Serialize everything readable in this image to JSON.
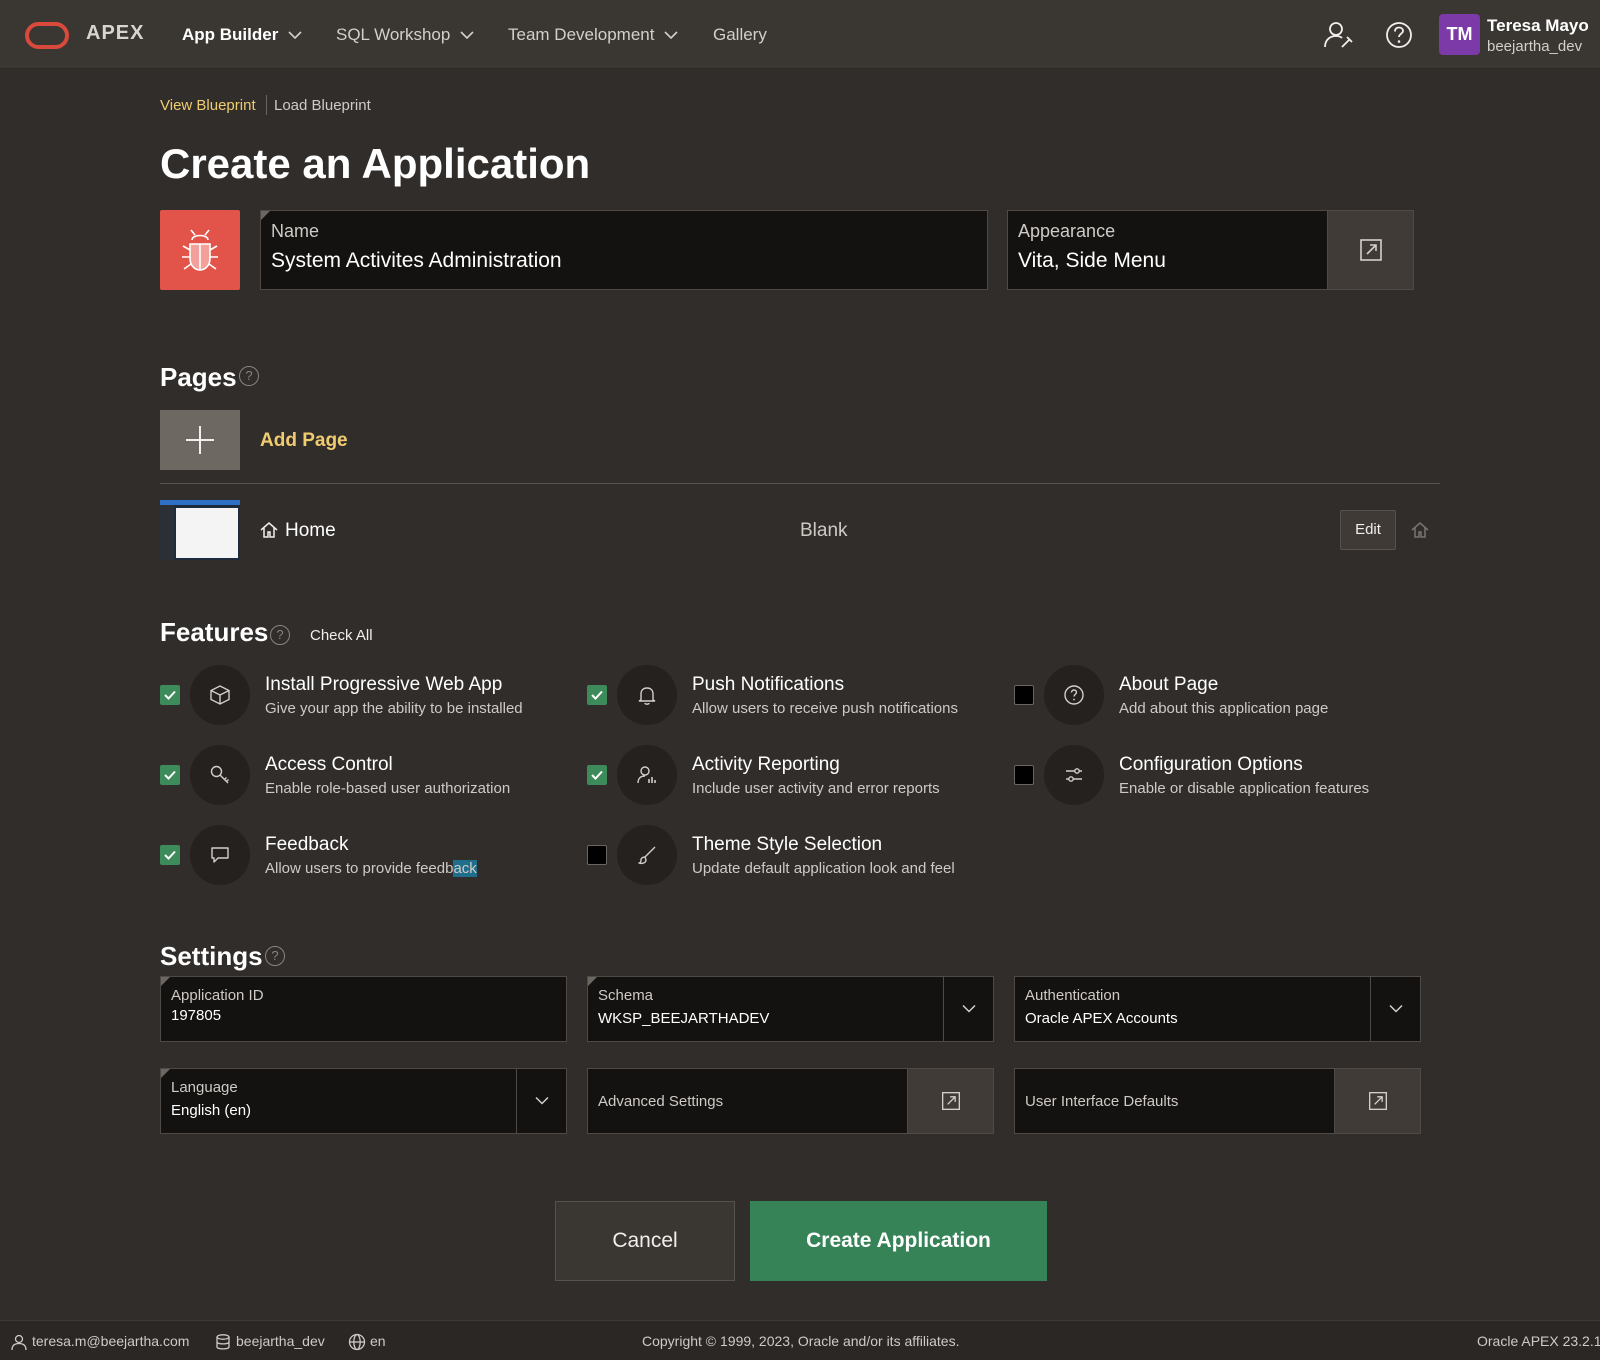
{
  "header": {
    "logo_text": "APEX",
    "nav": [
      {
        "label": "App Builder",
        "active": true
      },
      {
        "label": "SQL Workshop"
      },
      {
        "label": "Team Development"
      },
      {
        "label": "Gallery"
      }
    ],
    "user": {
      "initials": "TM",
      "name": "Teresa Mayo",
      "workspace": "beejartha_dev"
    }
  },
  "blueprint": {
    "view": "View Blueprint",
    "load": "Load Blueprint"
  },
  "title": "Create an Application",
  "name_field": {
    "label": "Name",
    "value": "System Activites Administration"
  },
  "appearance_field": {
    "label": "Appearance",
    "value": "Vita, Side Menu"
  },
  "pages": {
    "heading": "Pages",
    "add_label": "Add Page",
    "rows": [
      {
        "name": "Home",
        "type": "Blank",
        "edit_label": "Edit"
      }
    ]
  },
  "features": {
    "heading": "Features",
    "check_all": "Check All",
    "items": [
      {
        "title": "Install Progressive Web App",
        "desc": "Give your app the ability to be installed",
        "checked": true,
        "icon": "box-icon"
      },
      {
        "title": "Push Notifications",
        "desc": "Allow users to receive push notifications",
        "checked": true,
        "icon": "bell-icon"
      },
      {
        "title": "About Page",
        "desc": "Add about this application page",
        "checked": false,
        "icon": "question-icon"
      },
      {
        "title": "Access Control",
        "desc": "Enable role-based user authorization",
        "checked": true,
        "icon": "key-icon"
      },
      {
        "title": "Activity Reporting",
        "desc": "Include user activity and error reports",
        "checked": true,
        "icon": "user-chart-icon"
      },
      {
        "title": "Configuration Options",
        "desc": "Enable or disable application features",
        "checked": false,
        "icon": "sliders-icon"
      },
      {
        "title": "Feedback",
        "desc_pre": "Allow users to provide feedb",
        "desc_hl": "ack",
        "checked": true,
        "icon": "speech-bubble-icon"
      },
      {
        "title": "Theme Style Selection",
        "desc": "Update default application look and feel",
        "checked": false,
        "icon": "brush-icon"
      }
    ]
  },
  "settings": {
    "heading": "Settings",
    "app_id": {
      "label": "Application ID",
      "value": "197805"
    },
    "schema": {
      "label": "Schema",
      "value": "WKSP_BEEJARTHADEV"
    },
    "auth": {
      "label": "Authentication",
      "value": "Oracle APEX Accounts"
    },
    "language": {
      "label": "Language",
      "value": "English (en)"
    },
    "advanced": "Advanced Settings",
    "ui_defaults": "User Interface Defaults"
  },
  "buttons": {
    "cancel": "Cancel",
    "create": "Create Application"
  },
  "footer": {
    "email": "teresa.m@beejartha.com",
    "workspace": "beejartha_dev",
    "lang": "en",
    "copyright": "Copyright © 1999, 2023, Oracle and/or its affiliates.",
    "version": "Oracle APEX 23.2.1"
  },
  "colors": {
    "accent_yellow": "#f0cc71",
    "primary_green": "#378358",
    "checked_green": "#3d8a5a",
    "app_icon_red": "#e2534a"
  }
}
